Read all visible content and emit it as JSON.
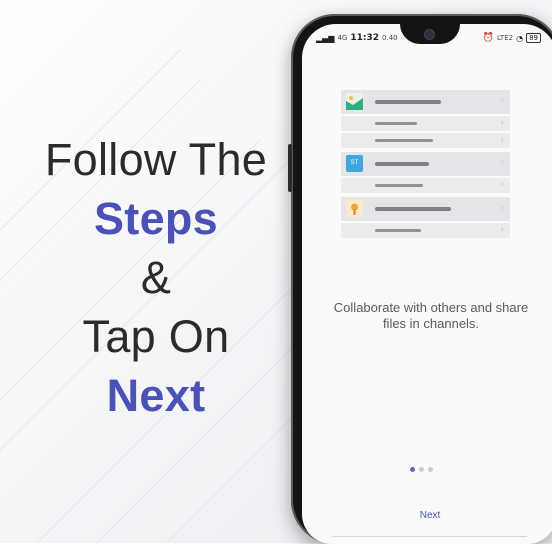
{
  "promo": {
    "line1": "Follow The",
    "line2": "Steps",
    "line3": "&",
    "line4": "Tap On",
    "line5": "Next"
  },
  "status_bar": {
    "signal": "ᵢₗₗ",
    "network": "4G",
    "time": "11:32",
    "speed": "0.40",
    "right_icons": "⏰",
    "volte": "LTE2",
    "battery": "89"
  },
  "screen": {
    "tagline": "Collaborate with others and share files in channels.",
    "next_label": "Next",
    "page_dots": 3,
    "active_dot": 0
  },
  "colors": {
    "accent": "#4a52b5",
    "thumb_green": "#2eaf7d",
    "thumb_blue": "#3ea7dc",
    "thumb_orange": "#f2a43a"
  },
  "thumbs": {
    "second_label": "ST"
  }
}
